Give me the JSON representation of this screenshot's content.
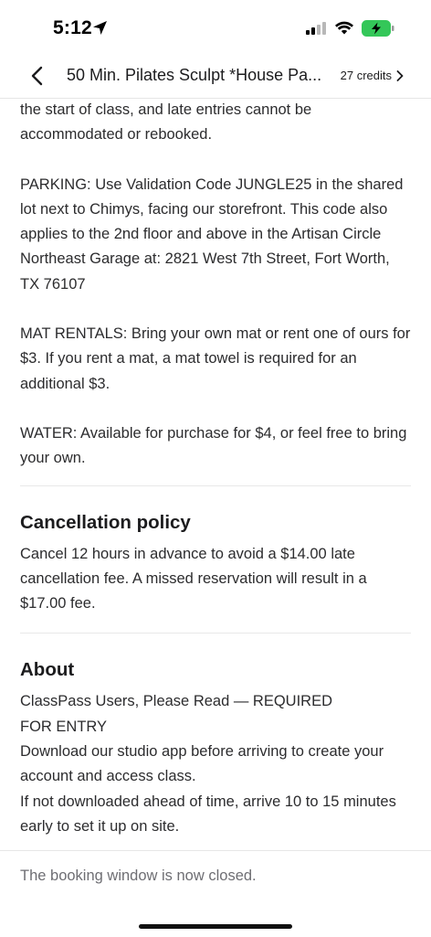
{
  "status_bar": {
    "time": "5:12",
    "icons": [
      "location-arrow-icon",
      "cellular-signal-icon",
      "wifi-icon",
      "battery-charging-icon"
    ],
    "battery_color": "#34c759"
  },
  "nav": {
    "back_icon": "chevron-left-icon",
    "title": "50 Min. Pilates Sculpt *House Pa...",
    "credits_label": "27 credits",
    "credits_icon": "chevron-right-icon"
  },
  "details": {
    "paragraphs": [
      "the start of class, and late entries cannot be accommodated or rebooked.",
      "PARKING: Use Validation Code JUNGLE25 in the shared lot next to Chimys, facing our storefront. This code also applies to the 2nd floor and above in the Artisan Circle Northeast Garage at: 2821 West 7th Street, Fort Worth, TX 76107",
      "MAT RENTALS: Bring your own mat or rent one of ours for $3. If you rent a mat, a mat towel is required for an additional $3.",
      "WATER: Available for purchase for $4, or feel free to bring your own."
    ]
  },
  "cancellation": {
    "title": "Cancellation policy",
    "body": "Cancel 12 hours in advance to avoid a $14.00 late cancellation fee. A missed reservation will result in a $17.00 fee."
  },
  "about": {
    "title": "About",
    "lines": [
      "ClassPass Users, Please Read — REQUIRED FOR ENTRY",
      "Download our studio app before arriving to create your account and access class.",
      "If not downloaded ahead of time, arrive 10 to 15 minutes early to set it up on site."
    ]
  },
  "footer": {
    "message": "The booking window is now closed."
  }
}
